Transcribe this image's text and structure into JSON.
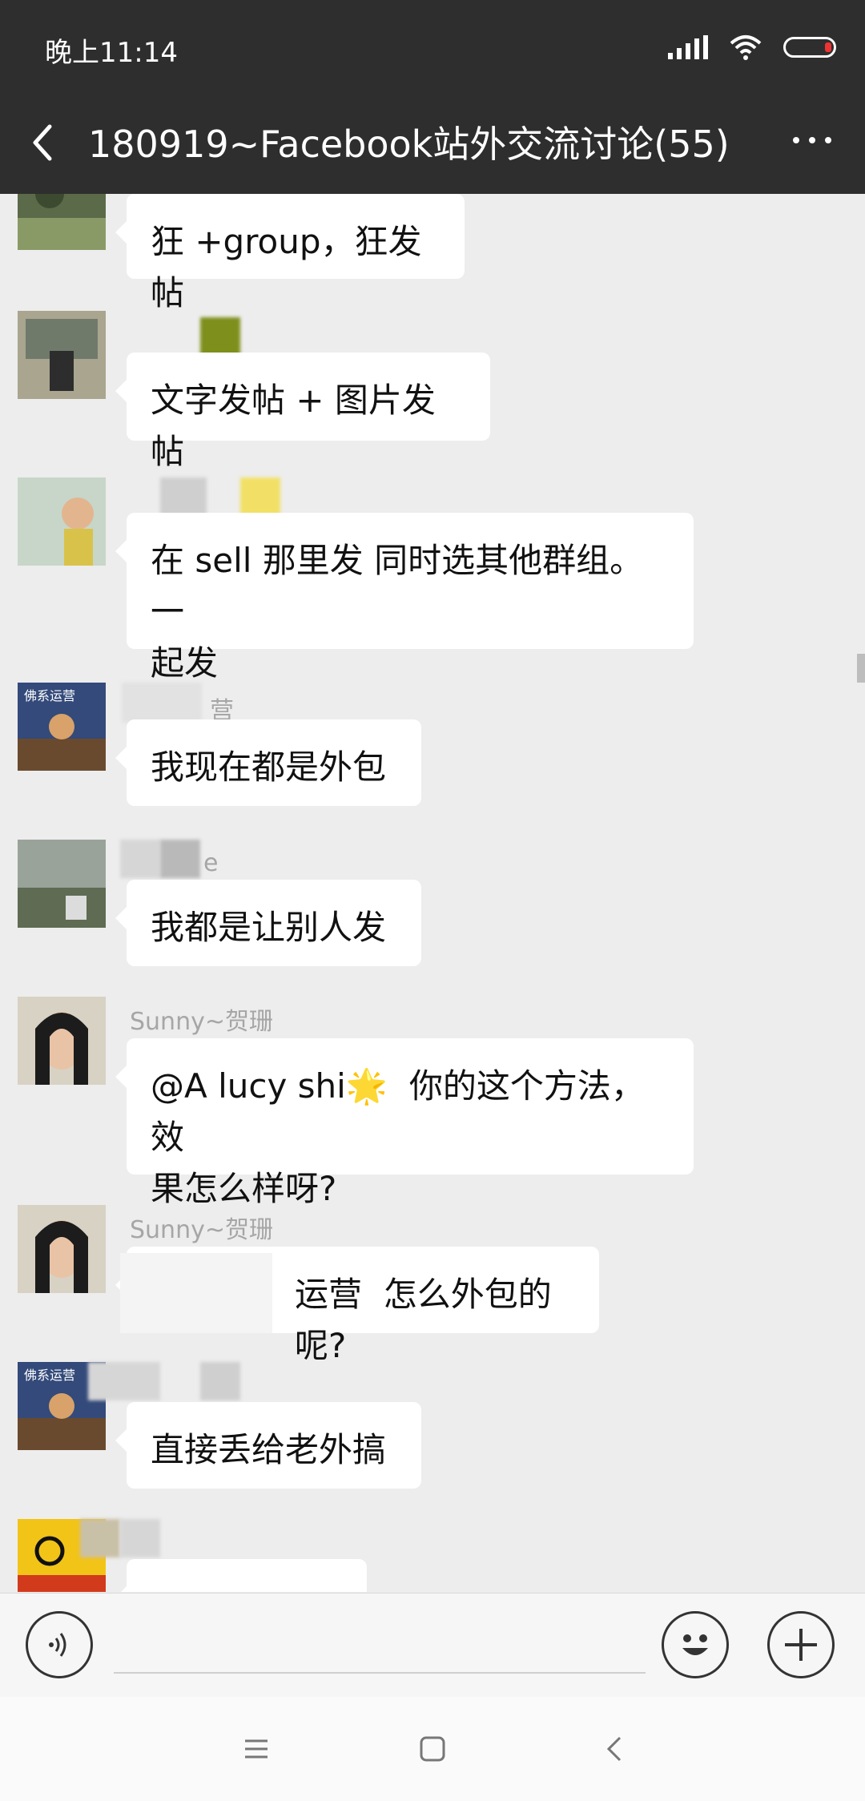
{
  "status_bar": {
    "time": "晚上11:14"
  },
  "header": {
    "title": "180919~Facebook站外交流讨论(55)"
  },
  "messages": [
    {
      "sender": "",
      "text": "狂 +group，狂发帖"
    },
    {
      "sender": "",
      "text": "文字发帖 + 图片发帖"
    },
    {
      "sender": "",
      "text": "在 sell 那里发 同时选其他群组。一\n起发"
    },
    {
      "sender": "营",
      "text": "我现在都是外包"
    },
    {
      "sender": "e",
      "text": "我都是让别人发"
    },
    {
      "sender": "Sunny~贺珊",
      "text": "@A lucy shi🌟  你的这个方法，效\n果怎么样呀?"
    },
    {
      "sender": "Sunny~贺珊",
      "text": "运营  怎么外包的呢?"
    },
    {
      "sender": "",
      "text": "直接丢给老外搞"
    },
    {
      "sender": "",
      "text": ""
    }
  ],
  "avatars": {
    "buddha_label": "佛系运营"
  },
  "input_bar": {
    "placeholder": ""
  },
  "colors": {
    "header_bg": "#2e2e2e",
    "chat_bg": "#ededed",
    "bubble_bg": "#ffffff"
  },
  "icons": [
    "back-icon",
    "more-icon",
    "signal-icon",
    "wifi-icon",
    "battery-icon",
    "voice-icon",
    "emoji-icon",
    "plus-icon",
    "menu-icon",
    "home-icon",
    "nav-back-icon"
  ]
}
